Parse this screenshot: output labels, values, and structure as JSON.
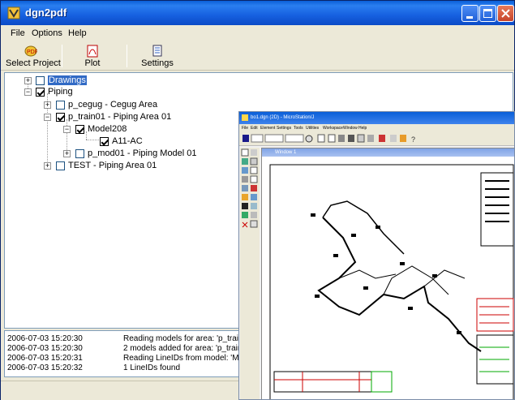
{
  "window": {
    "title": "dgn2pdf"
  },
  "menu": [
    "File",
    "Options",
    "Help"
  ],
  "toolbar": [
    {
      "label": "Select Project",
      "icon": "pdf-project-icon"
    },
    {
      "label": "Plot",
      "icon": "pdf-plot-icon"
    },
    {
      "label": "Settings",
      "icon": "settings-list-icon"
    }
  ],
  "tree": {
    "drawings": "Drawings",
    "piping": "Piping",
    "p_cegug": "p_cegug - Cegug Area",
    "p_train01": "p_train01 - Piping Area 01",
    "model208": "Model208",
    "a11ac": "A11-AC",
    "p_mod01": "p_mod01 - Piping Model 01",
    "test": "TEST - Piping Area 01"
  },
  "log": [
    {
      "time": "2006-07-03 15:20:30",
      "message": "Reading models for area: 'p_train01'"
    },
    {
      "time": "2006-07-03 15:20:30",
      "message": "2 models added for area: 'p_train01'"
    },
    {
      "time": "2006-07-03 15:20:31",
      "message": "Reading LineIDs from model: 'Model208'"
    },
    {
      "time": "2006-07-03 15:20:32",
      "message": "1 LineIDs found"
    }
  ],
  "microstation": {
    "title": "bo1.dgn (2D) - MicroStation/J",
    "menu": [
      "File",
      "Edit",
      "Element",
      "Settings",
      "Tools",
      "Utilities",
      "Workspace",
      "Window",
      "Help"
    ],
    "view_title": "Window 1"
  },
  "colors": {
    "titlebar": "#0a5fd8",
    "selection": "#316ac5"
  }
}
